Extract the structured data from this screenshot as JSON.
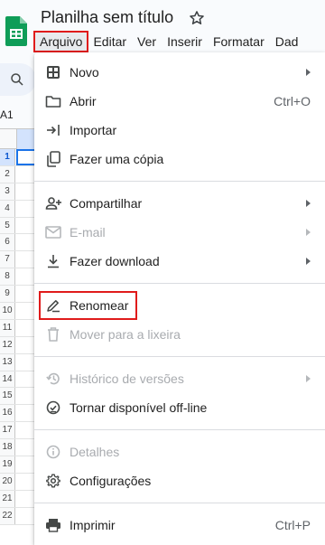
{
  "app": {
    "doc_title": "Planilha sem título",
    "brand_color": "#0f9d58"
  },
  "menubar": {
    "items": [
      "Arquivo",
      "Editar",
      "Ver",
      "Inserir",
      "Formatar",
      "Dad"
    ]
  },
  "sheet": {
    "namebox": "A1",
    "rows": [
      "1",
      "2",
      "3",
      "4",
      "5",
      "6",
      "7",
      "8",
      "9",
      "10",
      "11",
      "12",
      "13",
      "14",
      "15",
      "16",
      "17",
      "18",
      "19",
      "20",
      "21",
      "22"
    ]
  },
  "file_menu": {
    "new": {
      "label": "Novo"
    },
    "open": {
      "label": "Abrir",
      "shortcut": "Ctrl+O"
    },
    "import": {
      "label": "Importar"
    },
    "copy": {
      "label": "Fazer uma cópia"
    },
    "share": {
      "label": "Compartilhar"
    },
    "email": {
      "label": "E-mail"
    },
    "download": {
      "label": "Fazer download"
    },
    "rename": {
      "label": "Renomear"
    },
    "trash": {
      "label": "Mover para a lixeira"
    },
    "history": {
      "label": "Histórico de versões"
    },
    "offline": {
      "label": "Tornar disponível off-line"
    },
    "details": {
      "label": "Detalhes"
    },
    "settings": {
      "label": "Configurações"
    },
    "print": {
      "label": "Imprimir",
      "shortcut": "Ctrl+P"
    }
  }
}
